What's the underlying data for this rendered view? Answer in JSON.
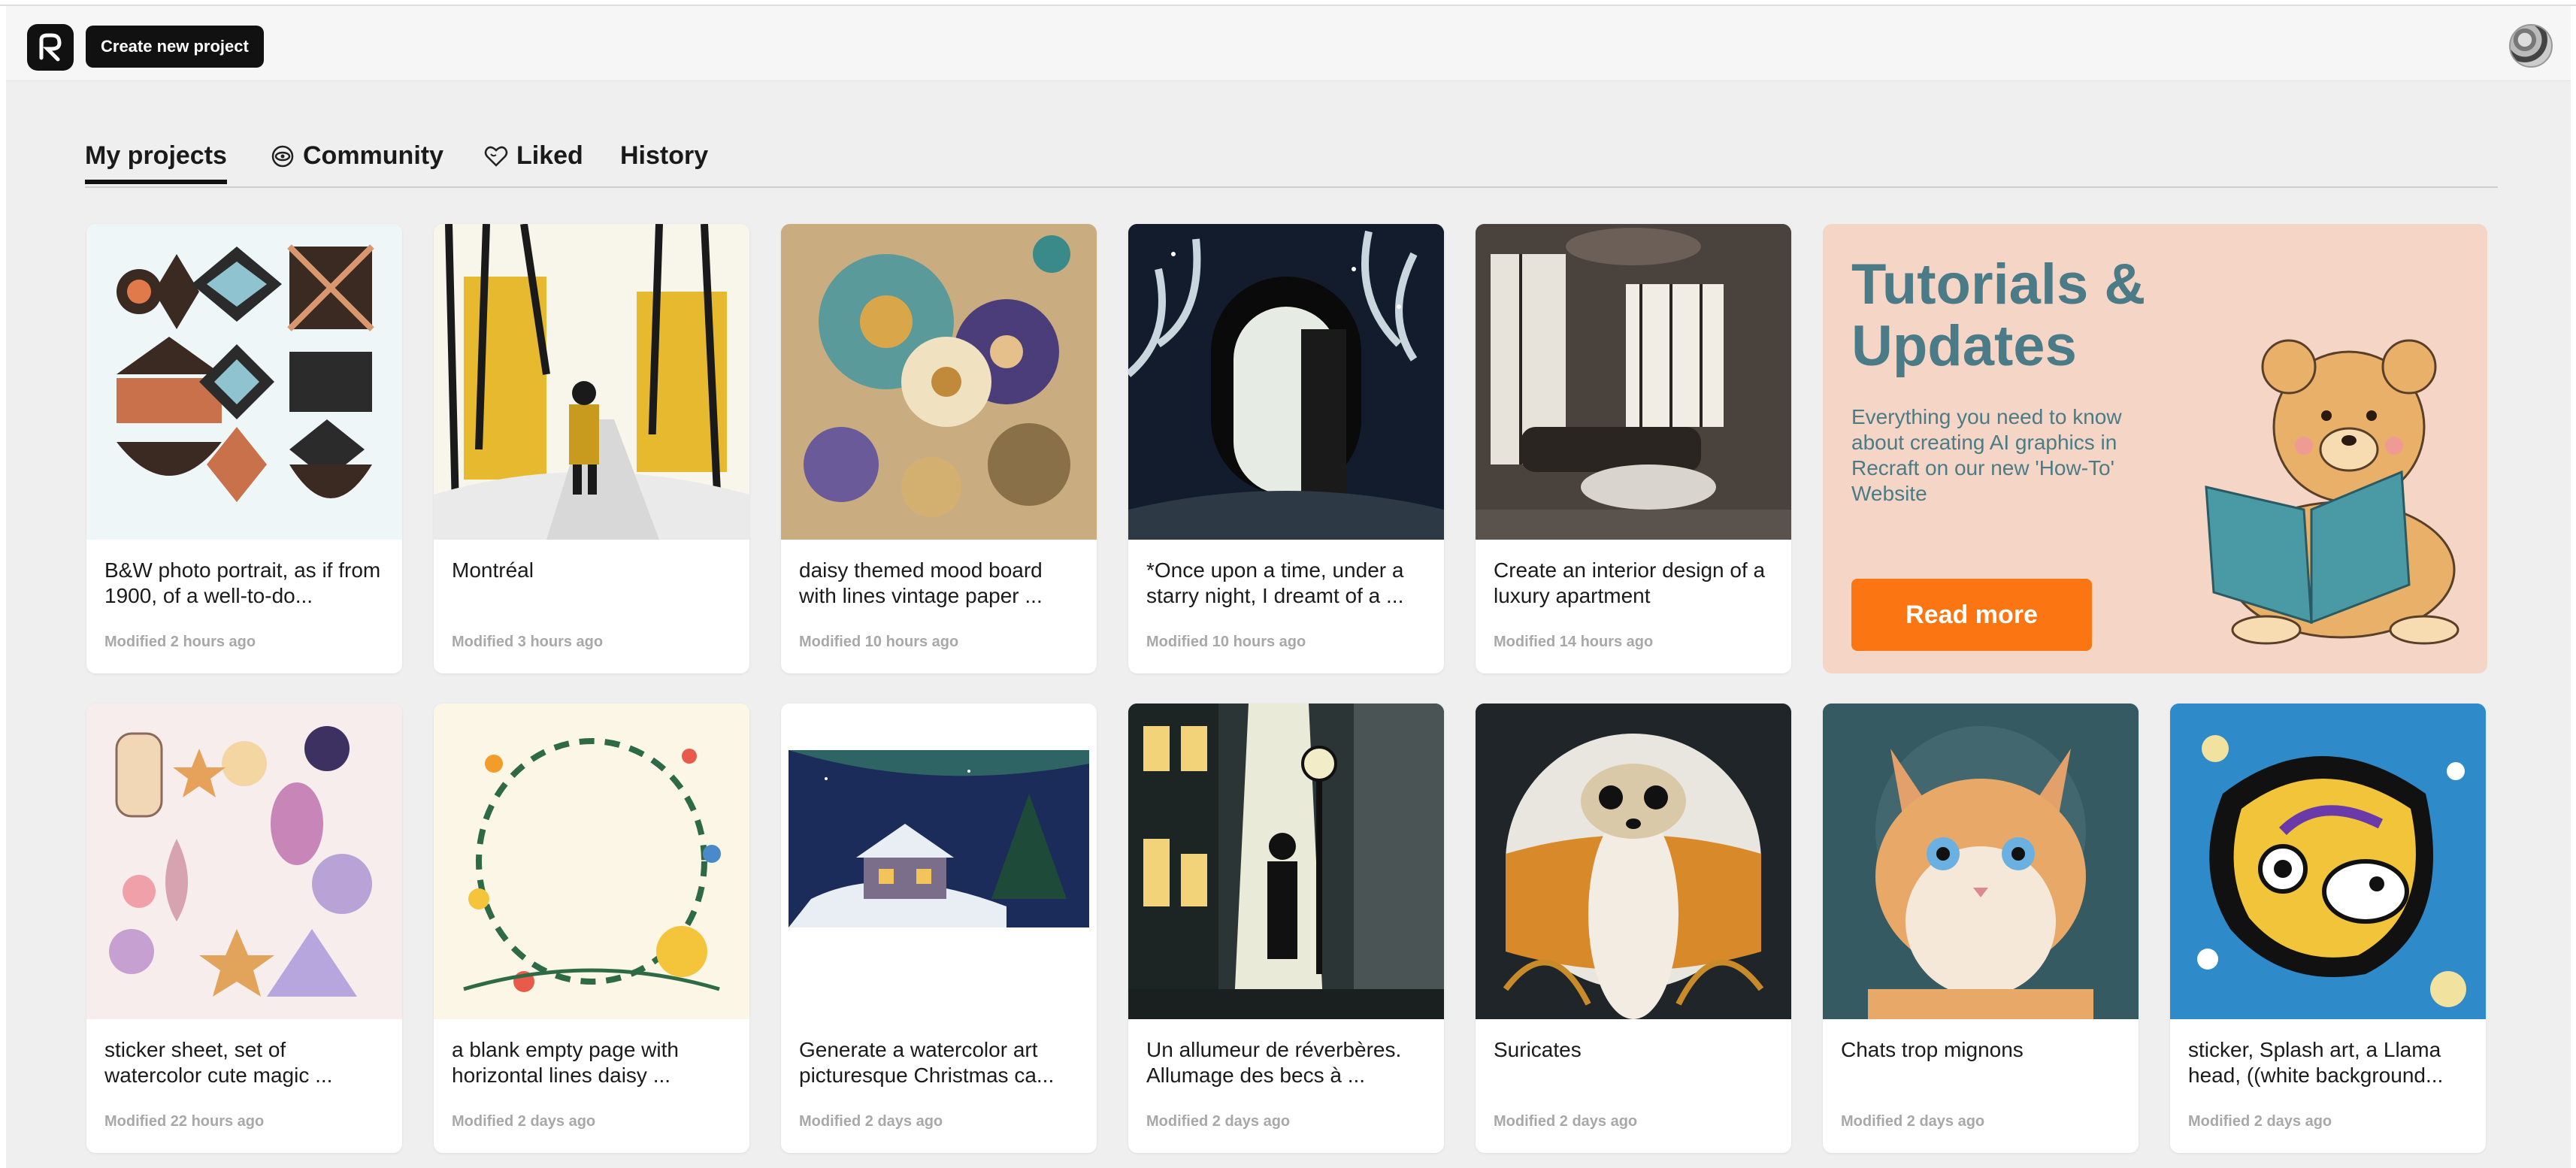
{
  "topbar": {
    "create_label": "Create new project"
  },
  "tabs": [
    {
      "label": "My projects",
      "icon": "none"
    },
    {
      "label": "Community",
      "icon": "community-icon"
    },
    {
      "label": "Liked",
      "icon": "heart-icon"
    },
    {
      "label": "History",
      "icon": "none"
    }
  ],
  "projects": [
    {
      "title": "B&W photo portrait, as if from 1900, of a well-to-do...",
      "modified": "Modified 2 hours ago"
    },
    {
      "title": "Montréal",
      "modified": "Modified 3 hours ago"
    },
    {
      "title": "daisy themed mood board with lines vintage paper ...",
      "modified": "Modified 10 hours ago"
    },
    {
      "title": "*Once upon a time, under a starry night, I dreamt of a ...",
      "modified": "Modified 10 hours ago"
    },
    {
      "title": "Create an interior design of a luxury apartment",
      "modified": "Modified 14 hours ago"
    },
    {
      "title": "sticker sheet, set of watercolor cute magic ...",
      "modified": "Modified 22 hours ago"
    },
    {
      "title": "a blank empty page with horizontal lines daisy ...",
      "modified": "Modified 2 days ago"
    },
    {
      "title": "Generate a watercolor art picturesque Christmas ca...",
      "modified": "Modified 2 days ago"
    },
    {
      "title": "Un allumeur de réverbères. Allumage des becs à ...",
      "modified": "Modified 2 days ago"
    },
    {
      "title": "Suricates",
      "modified": "Modified 2 days ago"
    },
    {
      "title": "Chats trop mignons",
      "modified": "Modified 2 days ago"
    },
    {
      "title": "sticker, Splash art, a Llama head, ((white background...",
      "modified": "Modified 2 days ago"
    }
  ],
  "tutorial": {
    "title": "Tutorials & Updates",
    "description": "Everything you need to know about creating AI graphics in Recraft on our new 'How-To' Website",
    "button_label": "Read more"
  },
  "colors": {
    "accent": "#fb7512",
    "tutorial_bg": "#f5d6c6",
    "tutorial_text": "#4a7b86"
  }
}
